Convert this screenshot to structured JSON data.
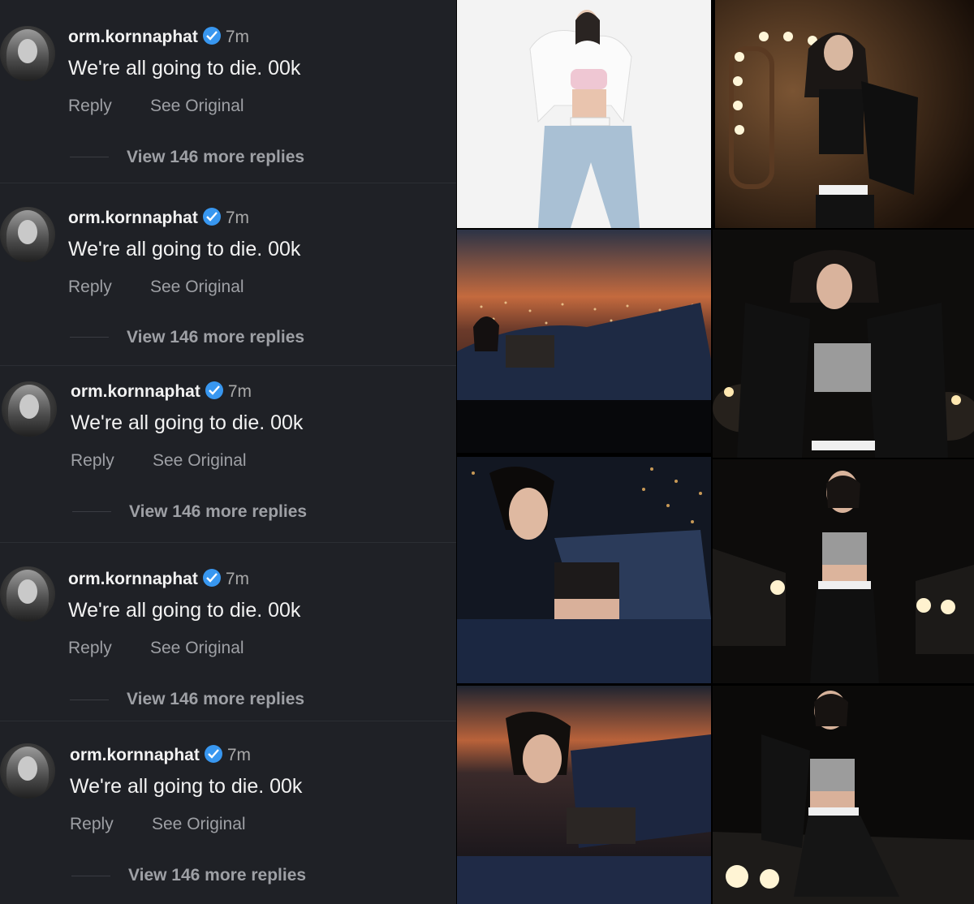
{
  "comments": [
    {
      "username": "orm.kornnaphat",
      "time": "7m",
      "text": "We're all going to die. 00k",
      "reply": "Reply",
      "see_original": "See Original",
      "view_more": "View 146 more replies"
    },
    {
      "username": "orm.kornnaphat",
      "time": "7m",
      "text": "We're all going to die. 00k",
      "reply": "Reply",
      "see_original": "See Original",
      "view_more": "View 146 more replies"
    },
    {
      "username": "orm.kornnaphat",
      "time": "7m",
      "text": "We're all going to die. 00k",
      "reply": "Reply",
      "see_original": "See Original",
      "view_more": "View 146 more replies"
    },
    {
      "username": "orm.kornnaphat",
      "time": "7m",
      "text": "We're all going to die. 00k",
      "reply": "Reply",
      "see_original": "See Original",
      "view_more": "View 146 more replies"
    },
    {
      "username": "orm.kornnaphat",
      "time": "7m",
      "text": "We're all going to die. 00k",
      "reply": "Reply",
      "see_original": "See Original",
      "view_more": "View 146 more replies"
    }
  ],
  "photos": [
    {
      "id": "studio-white"
    },
    {
      "id": "vanity-mirror"
    },
    {
      "id": "city-sunset-lying"
    },
    {
      "id": "night-street-hands-up"
    },
    {
      "id": "city-lights-lying"
    },
    {
      "id": "cars-standing"
    },
    {
      "id": "sunset-city-reclining"
    },
    {
      "id": "car-headlights-seated"
    }
  ],
  "colors": {
    "panel": "#1f2126",
    "verified": "#3897f0",
    "muted": "#9ea0a5"
  }
}
